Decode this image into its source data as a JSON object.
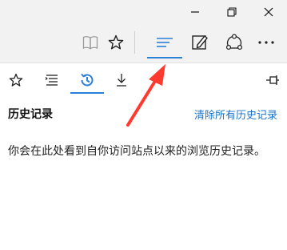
{
  "window": {
    "minimize_icon": "minimize-icon",
    "restore_icon": "restore-icon",
    "close_icon": "close-icon"
  },
  "toolbar": {
    "reading_view_icon": "book-icon",
    "favorite_icon": "star-icon",
    "hub_icon": "hub-lines-icon",
    "note_icon": "pen-note-icon",
    "share_icon": "share-icon",
    "more_icon": "more-icon",
    "accent": "#2b7fd6"
  },
  "hub": {
    "tabs": [
      {
        "icon": "star-icon"
      },
      {
        "icon": "reading-list-icon"
      },
      {
        "icon": "history-icon",
        "active": true
      },
      {
        "icon": "download-icon"
      }
    ],
    "pin_icon": "pin-icon",
    "title": "历史记录",
    "clear_label": "清除所有历史记录",
    "empty_message": "你会在此处看到自你访问站点以来的浏览历史记录。"
  },
  "annotation": {
    "color": "#ff3b30"
  }
}
